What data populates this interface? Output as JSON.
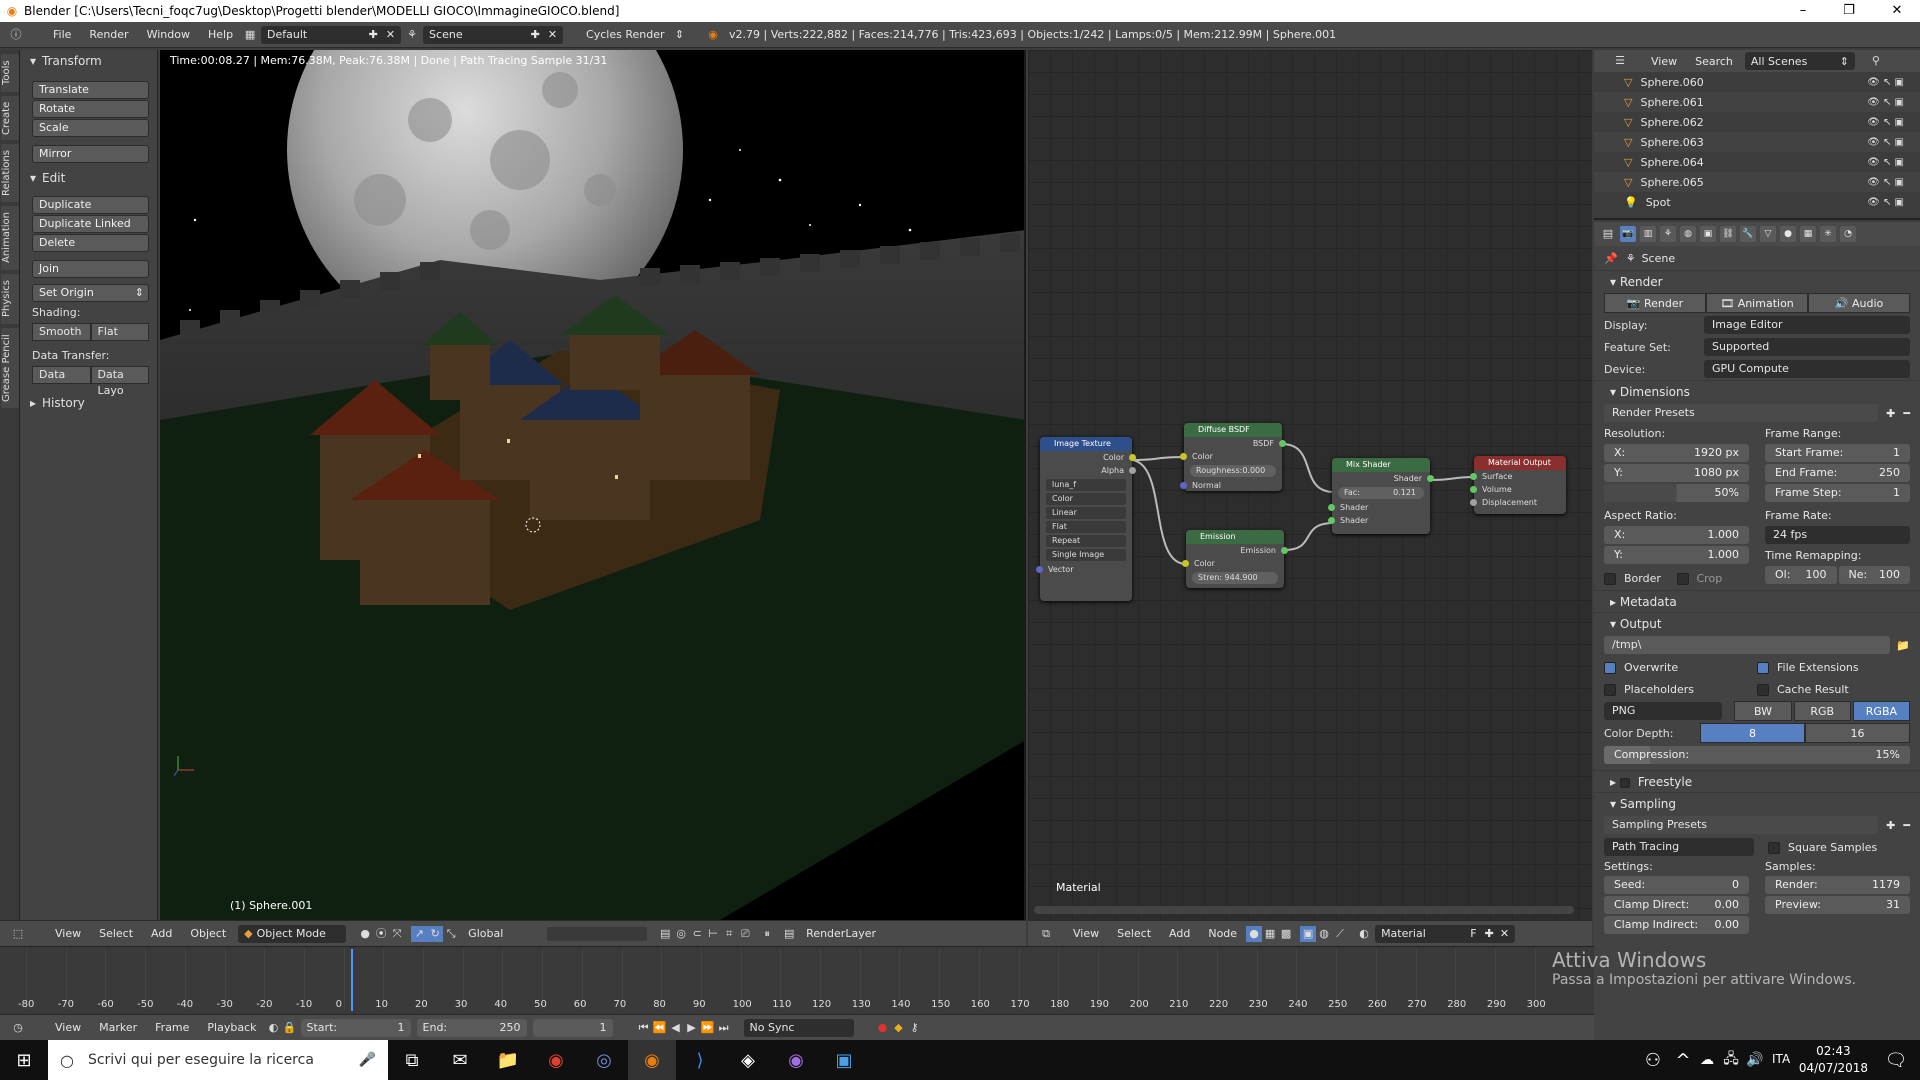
{
  "titlebar": {
    "title": "Blender [C:\\Users\\Tecni_foqc7ug\\Desktop\\Progetti blender\\MODELLI GIOCO\\ImmagineGIOCO.blend]",
    "minimize": "–",
    "maximize": "❐",
    "close": "✕"
  },
  "infobar": {
    "menus": [
      "File",
      "Render",
      "Window",
      "Help"
    ],
    "layout": "Default",
    "scene": "Scene",
    "engine": "Cycles Render",
    "stats": "v2.79 | Verts:222,882 | Faces:214,776 | Tris:423,693 | Objects:1/242 | Lamps:0/5 | Mem:212.99M | Sphere.001"
  },
  "tool_tabs": [
    "Tools",
    "Create",
    "Relations",
    "Animation",
    "Physics",
    "Grease Pencil"
  ],
  "toolshelf": {
    "transform_title": "Transform",
    "translate": "Translate",
    "rotate": "Rotate",
    "scale": "Scale",
    "mirror": "Mirror",
    "edit_title": "Edit",
    "duplicate": "Duplicate",
    "duplicate_linked": "Duplicate Linked",
    "delete": "Delete",
    "join": "Join",
    "set_origin": "Set Origin",
    "shading_label": "Shading:",
    "smooth": "Smooth",
    "flat": "Flat",
    "data_transfer_label": "Data Transfer:",
    "data": "Data",
    "data_layo": "Data Layo",
    "history_title": "History"
  },
  "viewport": {
    "status": "Time:00:08.27 | Mem:76.38M, Peak:76.38M | Done | Path Tracing Sample 31/31",
    "object_label": "(1) Sphere.001"
  },
  "viewport_header": {
    "view": "View",
    "select": "Select",
    "add": "Add",
    "object": "Object",
    "mode": "Object Mode",
    "orientation": "Global",
    "layer": "RenderLayer"
  },
  "nodes": {
    "image_texture": {
      "title": "Image Texture",
      "out_color": "Color",
      "out_alpha": "Alpha",
      "image": "luna_f",
      "color": "Color",
      "linear": "Linear",
      "flat": "Flat",
      "repeat": "Repeat",
      "single": "Single Image",
      "vector": "Vector"
    },
    "diffuse": {
      "title": "Diffuse BSDF",
      "out": "BSDF",
      "color": "Color",
      "roughness": "Roughness:0.000",
      "normal": "Normal"
    },
    "emission": {
      "title": "Emission",
      "out": "Emission",
      "color": "Color",
      "strength": "Stren: 944.900"
    },
    "mix": {
      "title": "Mix Shader",
      "out": "Shader",
      "fac": "Fac:",
      "fac_value": "0.121",
      "shader1": "Shader",
      "shader2": "Shader"
    },
    "output": {
      "title": "Material Output",
      "surface": "Surface",
      "volume": "Volume",
      "displacement": "Displacement"
    },
    "label": "Material"
  },
  "node_header": {
    "view": "View",
    "select": "Select",
    "add": "Add",
    "node": "Node",
    "material": "Material",
    "fake": "F"
  },
  "outliner": {
    "view": "View",
    "search": "Search",
    "filter": "All Scenes",
    "items": [
      "Sphere.060",
      "Sphere.061",
      "Sphere.062",
      "Sphere.063",
      "Sphere.064",
      "Sphere.065",
      "Spot"
    ]
  },
  "properties": {
    "scene": "Scene",
    "render_section": "Render",
    "render_btn": "Render",
    "animation_btn": "Animation",
    "audio_btn": "Audio",
    "display_label": "Display:",
    "display_value": "Image Editor",
    "feature_label": "Feature Set:",
    "feature_value": "Supported",
    "device_label": "Device:",
    "device_value": "GPU Compute",
    "dimensions_section": "Dimensions",
    "render_presets": "Render Presets",
    "resolution_label": "Resolution:",
    "res_x_label": "X:",
    "res_x": "1920 px",
    "res_y_label": "Y:",
    "res_y": "1080 px",
    "res_pct": "50%",
    "frame_range_label": "Frame Range:",
    "start_frame_label": "Start Frame:",
    "start_frame": "1",
    "end_frame_label": "End Frame:",
    "end_frame": "250",
    "frame_step_label": "Frame Step:",
    "frame_step": "1",
    "aspect_label": "Aspect Ratio:",
    "aspect_x_label": "X:",
    "aspect_x": "1.000",
    "aspect_y_label": "Y:",
    "aspect_y": "1.000",
    "frame_rate_label": "Frame Rate:",
    "frame_rate": "24 fps",
    "time_remap_label": "Time Remapping:",
    "old_label": "Ol:",
    "old": "100",
    "new_label": "Ne:",
    "new": "100",
    "border": "Border",
    "crop": "Crop",
    "metadata_section": "Metadata",
    "output_section": "Output",
    "output_path": "/tmp\\",
    "overwrite": "Overwrite",
    "file_ext": "File Extensions",
    "placeholders": "Placeholders",
    "cache_result": "Cache Result",
    "format": "PNG",
    "bw": "BW",
    "rgb": "RGB",
    "rgba": "RGBA",
    "color_depth_label": "Color Depth:",
    "depth_8": "8",
    "depth_16": "16",
    "compression_label": "Compression:",
    "compression": "15%",
    "freestyle_section": "Freestyle",
    "sampling_section": "Sampling",
    "sampling_presets": "Sampling Presets",
    "integrator": "Path Tracing",
    "square_samples": "Square Samples",
    "settings_label": "Settings:",
    "samples_label": "Samples:",
    "seed_label": "Seed:",
    "seed": "0",
    "render_samples_label": "Render:",
    "render_samples": "1179",
    "preview_label": "Preview:",
    "preview_samples": "31",
    "clamp_direct_label": "Clamp Direct:",
    "clamp_direct": "0.00",
    "clamp_indirect_label": "Clamp Indirect:",
    "clamp_indirect": "0.00"
  },
  "timeline": {
    "ticks": [
      "-80",
      "-70",
      "-60",
      "-50",
      "-40",
      "-30",
      "-20",
      "-10",
      "0",
      "10",
      "20",
      "30",
      "40",
      "50",
      "60",
      "70",
      "80",
      "90",
      "100",
      "110",
      "120",
      "130",
      "140",
      "150",
      "160",
      "170",
      "180",
      "190",
      "200",
      "210",
      "220",
      "230",
      "240",
      "250",
      "260",
      "270",
      "280",
      "290",
      "300"
    ],
    "current_frame": "1"
  },
  "timeline_header": {
    "view": "View",
    "marker": "Marker",
    "frame": "Frame",
    "playback": "Playback",
    "start_label": "Start:",
    "start": "1",
    "end_label": "End:",
    "end": "250",
    "current": "1",
    "sync": "No Sync"
  },
  "watermark": {
    "line1": "Attiva Windows",
    "line2": "Passa a Impostazioni per attivare Windows."
  },
  "taskbar": {
    "search_placeholder": "Scrivi qui per eseguire la ricerca",
    "language": "ITA",
    "time": "02:43",
    "date": "04/07/2018"
  }
}
